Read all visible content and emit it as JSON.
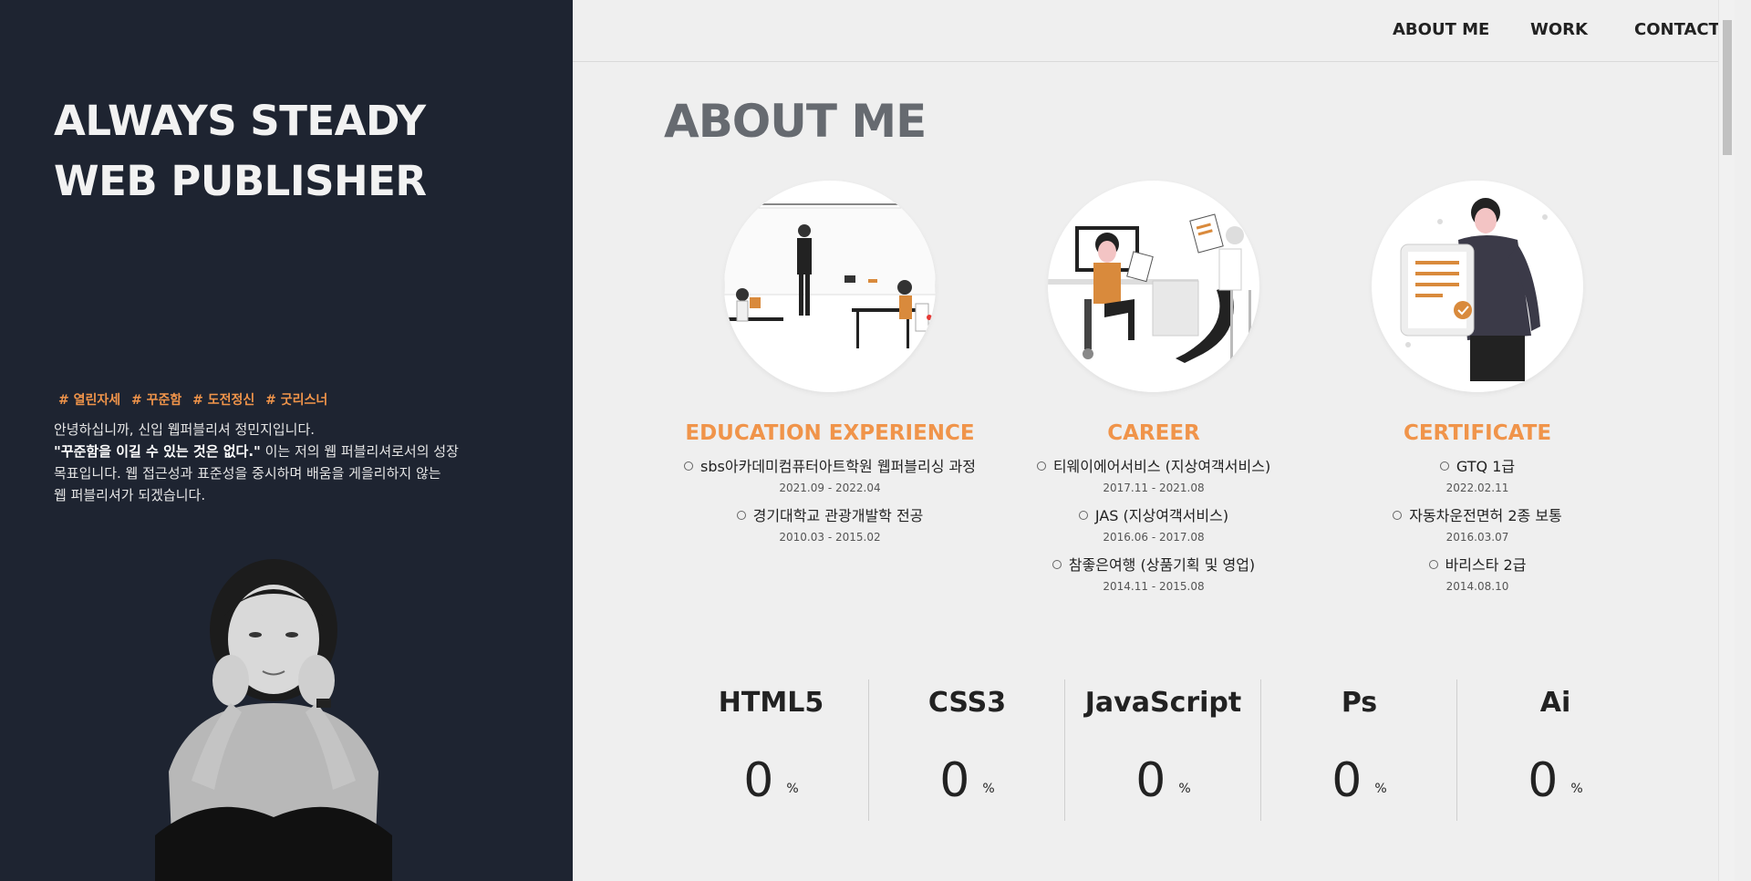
{
  "hero": {
    "title_line1": "ALWAYS STEADY",
    "title_line2": "WEB PUBLISHER",
    "tags": [
      "# 열린자세",
      "# 꾸준함",
      "# 도전정신",
      "# 굿리스너"
    ],
    "intro_line1": "안녕하십니까, 신입 웹퍼블리셔 정민지입니다.",
    "intro_quote": "\"꾸준함을 이길 수 있는 것은 없다.\"",
    "intro_line2_rest": " 이는 저의 웹 퍼블리셔로서의 성장",
    "intro_line3": "목표입니다. 웹 접근성과 표준성을 중시하며 배움을 게을리하지 않는",
    "intro_line4": "웹 퍼블리셔가 되겠습니다."
  },
  "nav": {
    "about": "ABOUT ME",
    "work": "WORK",
    "contact": "CONTACT"
  },
  "about": {
    "title": "ABOUT ME",
    "education": {
      "title": "EDUCATION EXPERIENCE",
      "items": [
        {
          "name": "sbs아카데미컴퓨터아트학원 웹퍼블리싱 과정",
          "date": "2021.09 - 2022.04"
        },
        {
          "name": "경기대학교 관광개발학 전공",
          "date": "2010.03 - 2015.02"
        }
      ]
    },
    "career": {
      "title": "CAREER",
      "items": [
        {
          "name": "티웨이에어서비스 (지상여객서비스)",
          "date": "2017.11 - 2021.08"
        },
        {
          "name": "JAS (지상여객서비스)",
          "date": "2016.06 - 2017.08"
        },
        {
          "name": "참좋은여행 (상품기획 및 영업)",
          "date": "2014.11 - 2015.08"
        }
      ]
    },
    "certificate": {
      "title": "CERTIFICATE",
      "items": [
        {
          "name": "GTQ 1급",
          "date": "2022.02.11"
        },
        {
          "name": "자동차운전면허 2종 보통",
          "date": "2016.03.07"
        },
        {
          "name": "바리스타 2급",
          "date": "2014.08.10"
        }
      ]
    }
  },
  "skills": [
    {
      "name": "HTML5",
      "value": "0",
      "unit": "%"
    },
    {
      "name": "CSS3",
      "value": "0",
      "unit": "%"
    },
    {
      "name": "JavaScript",
      "value": "0",
      "unit": "%"
    },
    {
      "name": "Ps",
      "value": "0",
      "unit": "%"
    },
    {
      "name": "Ai",
      "value": "0",
      "unit": "%"
    }
  ],
  "colors": {
    "left_bg": "#1e2431",
    "accent": "#f0944a",
    "right_bg": "#efefef"
  }
}
